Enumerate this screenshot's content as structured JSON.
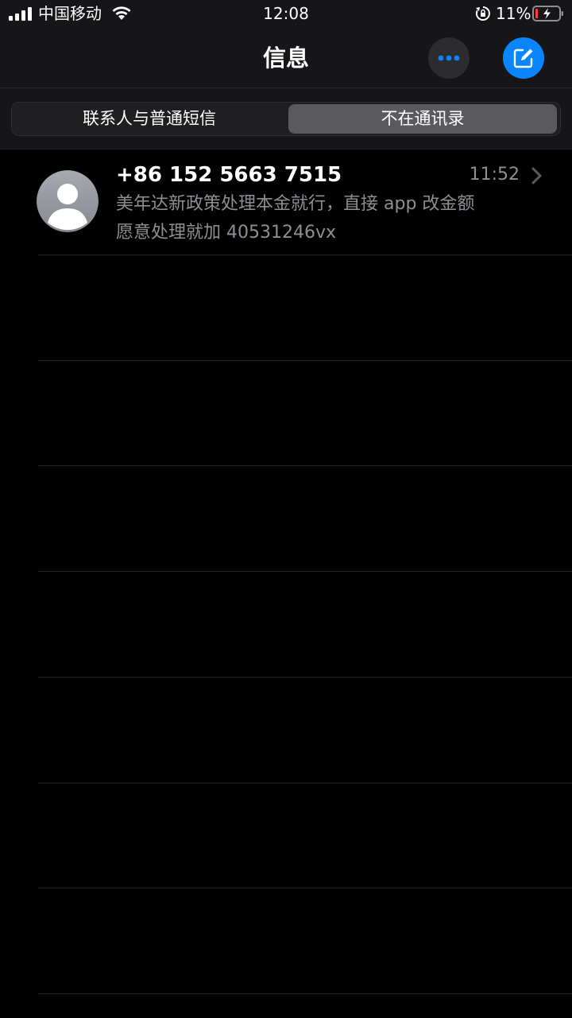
{
  "status_bar": {
    "carrier": "中国移动",
    "time": "12:08",
    "battery_percent": "11%",
    "battery_level": 0.11,
    "icons": [
      "signal-icon",
      "wifi-icon",
      "rotation-lock-icon",
      "battery-charging-icon"
    ]
  },
  "header": {
    "title": "信息",
    "more_icon": "ellipsis-icon",
    "compose_icon": "compose-icon"
  },
  "tabs": [
    {
      "label": "联系人与普通短信",
      "selected": false
    },
    {
      "label": "不在通讯录",
      "selected": true
    }
  ],
  "conversations": [
    {
      "sender": "+86 152 5663 7515",
      "time": "11:52",
      "preview_line1": "美年达新政策处理本金就行，直接 app 改金额",
      "preview_line2": "愿意处理就加 40531246vx",
      "avatar_icon": "person-avatar-icon"
    }
  ],
  "colors": {
    "background": "#000000",
    "header_background": "#161618",
    "accent": "#0a84ff",
    "secondary_text": "#8e8e93",
    "battery_low": "#ff3b30"
  }
}
